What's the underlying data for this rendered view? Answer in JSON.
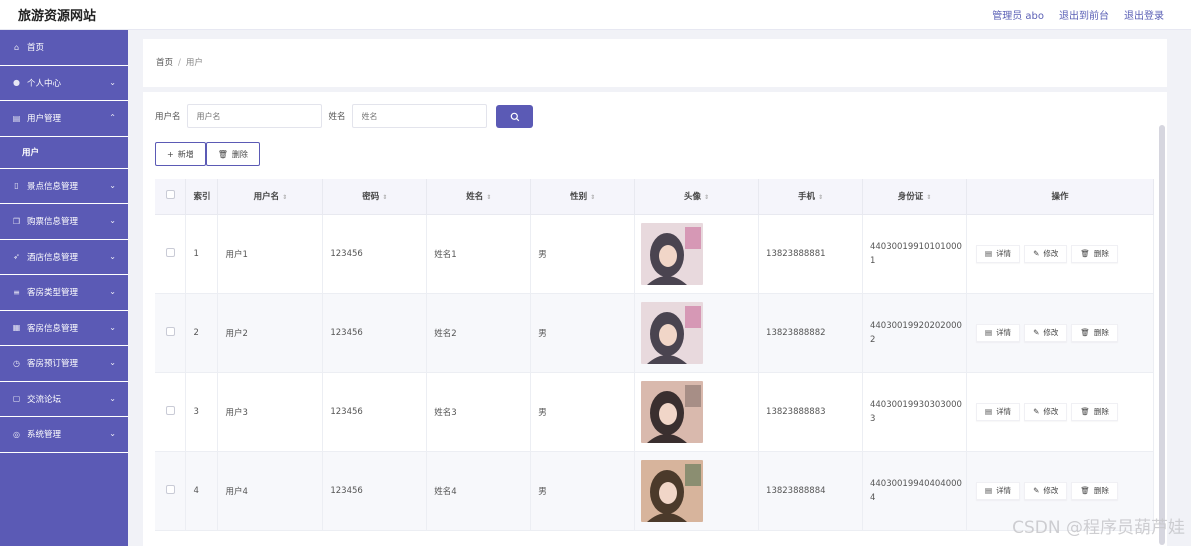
{
  "app": {
    "title": "旅游资源网站"
  },
  "topnav": {
    "admin": "管理员 abo",
    "front": "退出到前台",
    "logout": "退出登录"
  },
  "sidebar": {
    "items": [
      {
        "label": "首页",
        "icon": "home-icon",
        "chev": ""
      },
      {
        "label": "个人中心",
        "icon": "user-icon",
        "chev": "⌄"
      },
      {
        "label": "用户管理",
        "icon": "users-icon",
        "chev": "⌃"
      },
      {
        "label": "用户",
        "sub": true
      },
      {
        "label": "景点信息管理",
        "icon": "phone-icon",
        "chev": "⌄"
      },
      {
        "label": "购票信息管理",
        "icon": "copy-icon",
        "chev": "⌄"
      },
      {
        "label": "酒店信息管理",
        "icon": "send-icon",
        "chev": "⌄"
      },
      {
        "label": "客房类型管理",
        "icon": "list-icon",
        "chev": "⌄"
      },
      {
        "label": "客房信息管理",
        "icon": "doc-icon",
        "chev": "⌄"
      },
      {
        "label": "客房预订管理",
        "icon": "clock-icon",
        "chev": "⌄"
      },
      {
        "label": "交流论坛",
        "icon": "chat-icon",
        "chev": "⌄"
      },
      {
        "label": "系统管理",
        "icon": "gear-icon",
        "chev": "⌄"
      }
    ]
  },
  "breadcrumb": {
    "home": "首页",
    "sep": "/",
    "current": "用户"
  },
  "search": {
    "username_label": "用户名",
    "username_placeholder": "用户名",
    "name_label": "姓名",
    "name_placeholder": "姓名"
  },
  "actions": {
    "add": "新增",
    "delete": "删除"
  },
  "table": {
    "headers": [
      "",
      "索引",
      "用户名",
      "密码",
      "姓名",
      "性别",
      "头像",
      "手机",
      "身份证",
      "操作"
    ],
    "rows": [
      {
        "index": "1",
        "username": "用户1",
        "password": "123456",
        "name": "姓名1",
        "gender": "男",
        "phone": "13823888881",
        "id_line1": "44030019910101000",
        "id_line2": "1"
      },
      {
        "index": "2",
        "username": "用户2",
        "password": "123456",
        "name": "姓名2",
        "gender": "男",
        "phone": "13823888882",
        "id_line1": "44030019920202000",
        "id_line2": "2"
      },
      {
        "index": "3",
        "username": "用户3",
        "password": "123456",
        "name": "姓名3",
        "gender": "男",
        "phone": "13823888883",
        "id_line1": "44030019930303000",
        "id_line2": "3"
      },
      {
        "index": "4",
        "username": "用户4",
        "password": "123456",
        "name": "姓名4",
        "gender": "男",
        "phone": "13823888884",
        "id_line1": "44030019940404000",
        "id_line2": "4"
      }
    ],
    "op_detail": "详情",
    "op_edit": "修改",
    "op_delete": "删除"
  },
  "watermark": "CSDN @程序员葫芦娃",
  "colors": {
    "accent": "#5b5ab5"
  }
}
